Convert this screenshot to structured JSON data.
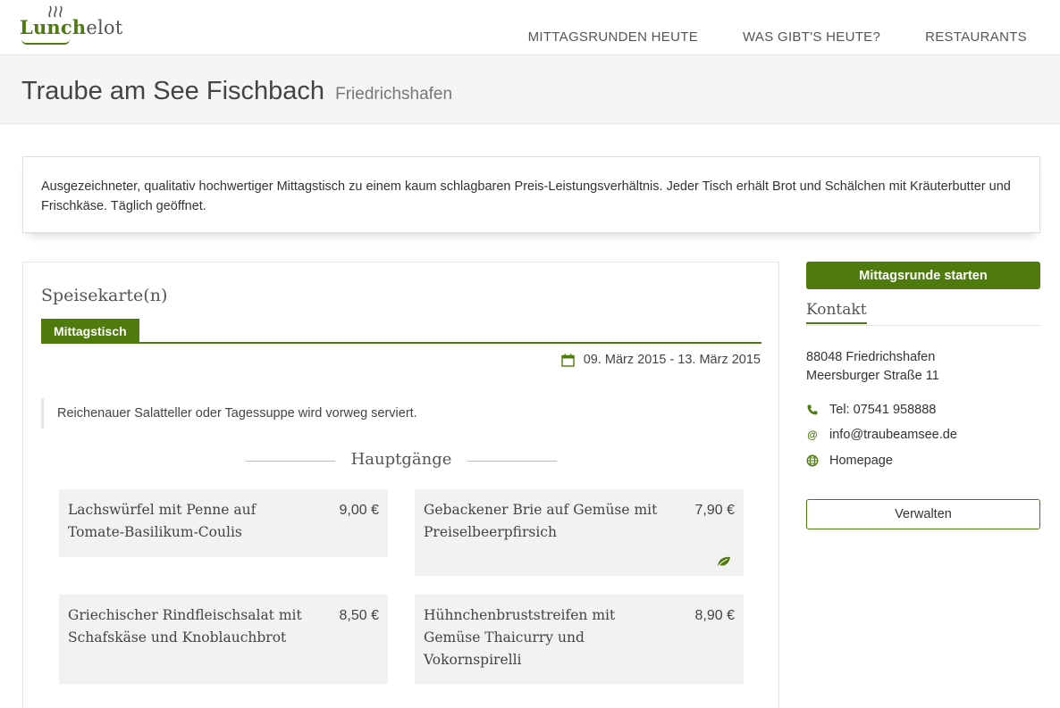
{
  "header": {
    "logo_text_1": "Lunch",
    "logo_text_2": "elot",
    "nav": [
      {
        "label": "MITTAGSRUNDEN HEUTE"
      },
      {
        "label": "WAS GIBT'S HEUTE?"
      },
      {
        "label": "RESTAURANTS"
      }
    ]
  },
  "restaurant": {
    "name": "Traube am See Fischbach",
    "city": "Friedrichshafen",
    "description": "Ausgezeichneter, qualitativ hochwertiger Mittagstisch zu einem kaum schlagbaren Preis-Leistungsverhältnis. Jeder Tisch erhält Brot und Schälchen mit Kräuterbutter und Frischkäse. Täglich geöffnet."
  },
  "menu": {
    "heading": "Speisekarte(n)",
    "tabs": [
      {
        "label": "Mittagstisch",
        "active": true
      }
    ],
    "date_range": "09. März 2015 - 13. März 2015",
    "note": "Reichenauer Salatteller oder Tagessuppe wird vorweg serviert.",
    "section_title": "Hauptgänge",
    "dishes": [
      {
        "name": "Lachswürfel mit Penne auf Tomate-Basilikum-Coulis",
        "price": "9,00 €",
        "vegetarian": false
      },
      {
        "name": "Gebackener Brie auf Gemüse mit Preiselbeerpfirsich",
        "price": "7,90 €",
        "vegetarian": true
      },
      {
        "name": "Griechischer Rindfleischsalat mit Schafskäse und Knoblauchbrot",
        "price": "8,50 €",
        "vegetarian": false
      },
      {
        "name": "Hühnchenbruststreifen mit Gemüse Thaicurry und Vokornspirelli",
        "price": "8,90 €",
        "vegetarian": false
      }
    ]
  },
  "sidebar": {
    "start_button": "Mittagsrunde starten",
    "contact_heading": "Kontakt",
    "address_line1": "88048 Friedrichshafen",
    "address_line2": "Meersburger Straße 11",
    "phone": "Tel: 07541 958888",
    "email": "info@traubeamsee.de",
    "homepage": "Homepage",
    "manage_button": "Verwalten"
  },
  "colors": {
    "accent": "#4e7a0e",
    "title_band": "#f5f5f5",
    "dish_bg": "#f2f2f2"
  },
  "icons": [
    "steam-icon",
    "calendar-icon",
    "leaf-icon",
    "phone-icon",
    "at-icon",
    "globe-icon"
  ]
}
